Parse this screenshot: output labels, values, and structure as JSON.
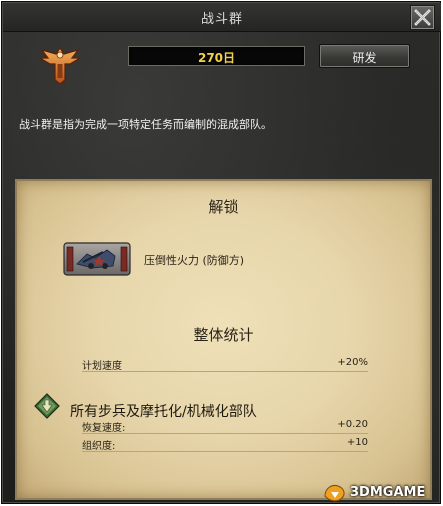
{
  "window": {
    "title": "战斗群",
    "close_icon": "close-icon"
  },
  "header": {
    "emblem_icon": "winged-eagle-icon",
    "days_value": "270日",
    "research_button_label": "研发",
    "description": "战斗群是指为完成一项特定任务而编制的混成部队。"
  },
  "unlock": {
    "heading": "解锁",
    "item_icon": "artillery-unit-badge-icon",
    "item_label": "压倒性火力 (防御方)"
  },
  "stats": {
    "heading": "整体统计",
    "rows": [
      {
        "label": "计划速度",
        "value": "+20%"
      }
    ]
  },
  "infantry": {
    "icon": "infantry-diamond-icon",
    "title": "所有步兵及摩托化/机械化部队",
    "rows": [
      {
        "label": "恢复速度:",
        "value": "+0.20"
      },
      {
        "label": "组织度:",
        "value": "+10"
      }
    ]
  },
  "watermark": {
    "text": "3DMGAME",
    "icon": "3dm-logo-icon"
  },
  "colors": {
    "days_text": "#f0d24a",
    "parchment": "#e7d6ab",
    "frame": "#262625"
  }
}
